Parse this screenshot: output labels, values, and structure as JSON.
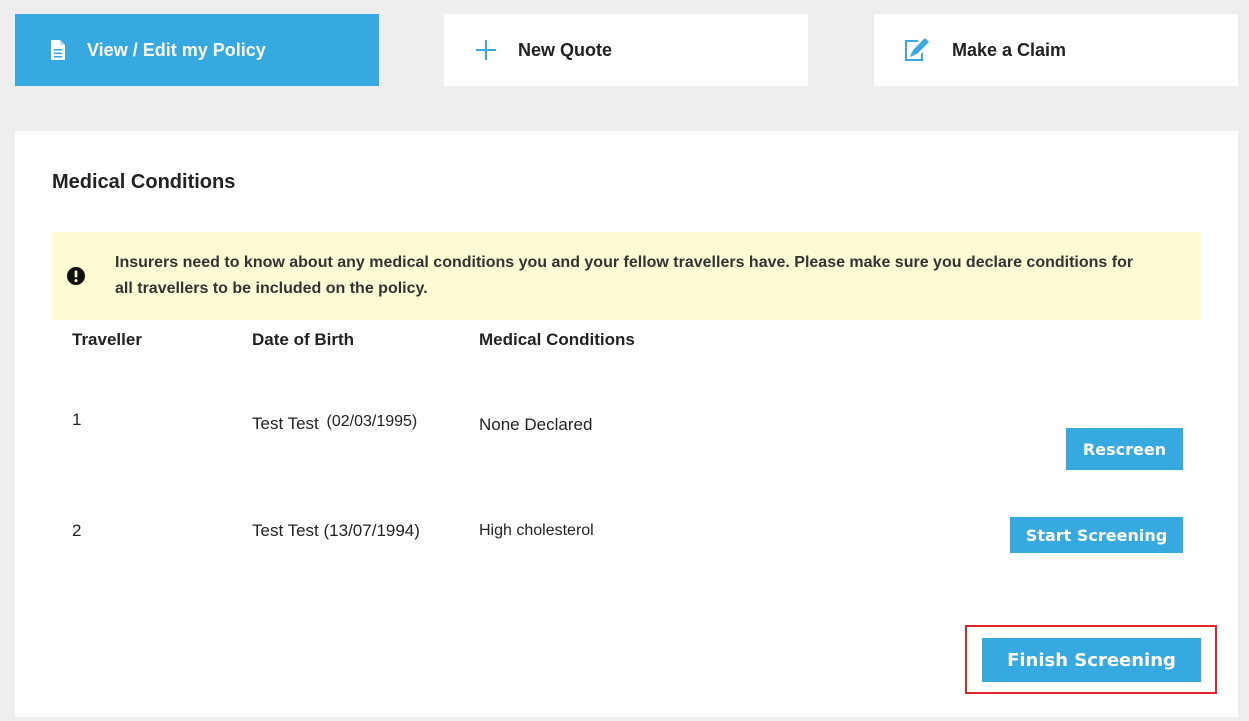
{
  "nav": {
    "view_edit_label": "View / Edit my Policy",
    "new_quote_label": "New Quote",
    "make_claim_label": "Make a Claim"
  },
  "panel": {
    "title": "Medical Conditions",
    "notice": "Insurers need to know about any medical conditions you and your fellow travellers have. Please make sure you declare conditions for all travellers to be included on the policy."
  },
  "table": {
    "headers": [
      "Traveller",
      "Date of Birth",
      "Medical Conditions"
    ],
    "rows": [
      {
        "number": "1",
        "name": "Test Test",
        "dob": "(02/03/1995)",
        "conditions": "None Declared",
        "action": "Rescreen"
      },
      {
        "number": "2",
        "name": "Test Test",
        "dob": "(13/07/1994)",
        "conditions": "High cholesterol",
        "action": "Start Screening"
      }
    ]
  },
  "finish_label": "Finish Screening",
  "colors": {
    "accent": "#36a9e1",
    "notice_bg": "#fdfbd3",
    "highlight": "#e0262b"
  },
  "icons": {
    "view_edit": "document-icon",
    "new_quote": "plus-icon",
    "make_claim": "edit-document-icon",
    "notice": "exclamation-icon"
  }
}
